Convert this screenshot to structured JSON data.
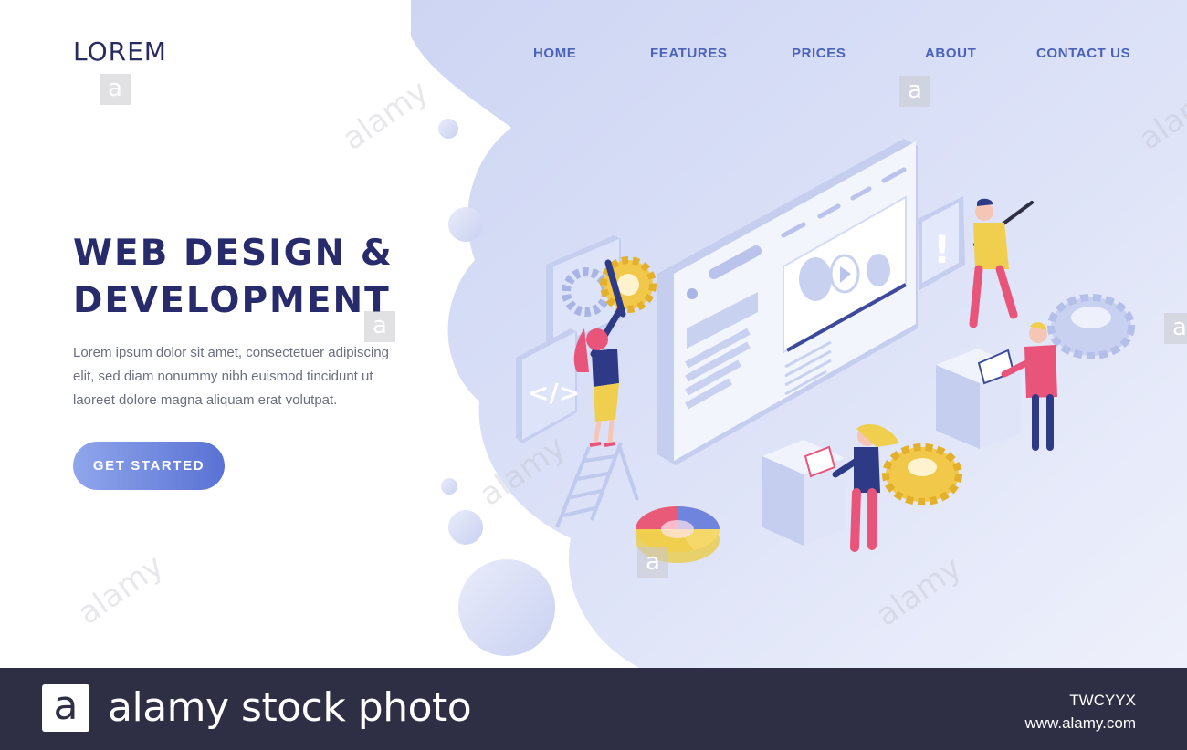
{
  "brand": {
    "logo": "LOREM"
  },
  "nav": {
    "items": [
      "HOME",
      "FEATURES",
      "PRICES",
      "ABOUT",
      "CONTACT US"
    ]
  },
  "hero": {
    "headline_line1": "WEB DESIGN &",
    "headline_line2": "DEVELOPMENT",
    "body": "Lorem ipsum dolor sit amet, consectetuer adipiscing elit, sed diam nonummy nibh euismod tincidunt ut laoreet dolore magna aliquam erat volutpat.",
    "cta_label": "GET STARTED"
  },
  "illustration": {
    "code_symbol": "</>",
    "alert_symbol": "!"
  },
  "watermark": {
    "text": "alamy",
    "letter": "a"
  },
  "footer": {
    "badge_letter": "a",
    "brand": "alamy stock photo",
    "image_id": "TWCYYX",
    "url": "www.alamy.com"
  },
  "colors": {
    "headline": "#272b6b",
    "nav": "#4a62b8",
    "accent_gradient_start": "#8fa6ec",
    "accent_gradient_end": "#5a72d4",
    "blob": "#d6dcf5",
    "footer_bg": "#2e2f45"
  }
}
